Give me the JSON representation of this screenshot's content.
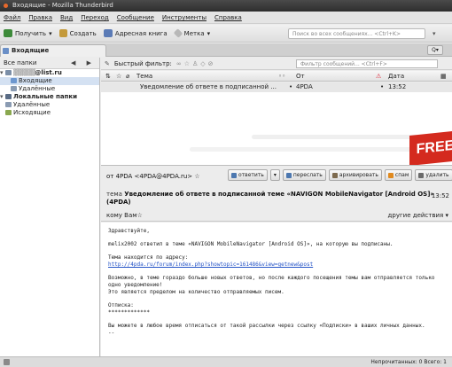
{
  "window": {
    "title": "Входящие - Mozilla Thunderbird"
  },
  "menu": [
    "Файл",
    "Правка",
    "Вид",
    "Переход",
    "Сообщение",
    "Инструменты",
    "Справка"
  ],
  "toolbar": {
    "get": "Получить",
    "write": "Создать",
    "addressbook": "Адресная книга",
    "tag": "Метка",
    "search_placeholder": "Поиск во всех сообщениях... <Ctrl+K>"
  },
  "tab": {
    "label": "Входящие"
  },
  "folders": {
    "header": "Все папки",
    "account": "@list.ru",
    "items": [
      {
        "label": "Входящие",
        "selected": true
      },
      {
        "label": "Удалённые"
      }
    ],
    "local": "Локальные папки",
    "local_items": [
      {
        "label": "Удалённые"
      },
      {
        "label": "Исходящие"
      }
    ]
  },
  "quickfilter": {
    "label": "Быстрый фильтр:",
    "placeholder": "Фильтр сообщений... <Ctrl+F>"
  },
  "columns": {
    "subject": "Тема",
    "from": "От",
    "date": "Дата"
  },
  "messages": [
    {
      "subject": "Уведомление об ответе в подписанной ...",
      "from": "4PDA",
      "date": "13:52"
    }
  ],
  "promo": "FREE",
  "message": {
    "from": "от 4PDA <4PDA@4PDA.ru>",
    "subject_label": "тема",
    "subject": "Уведомление об ответе в подписанной теме «NAVIGON MobileNavigator [Android OS]» (4PDA)",
    "time": "13:52",
    "to_label": "кому",
    "to": "Вам",
    "other_actions": "другие действия"
  },
  "actions": {
    "reply": "ответить",
    "forward": "переслать",
    "archive": "архивировать",
    "spam": "спам",
    "delete": "удалить"
  },
  "body": {
    "greeting": "Здравствуйте,",
    "line1": "melix2002 ответил в теме «NAVIGON MobileNavigator [Android OS]», на которую вы подписаны.",
    "topic_label": "Тема находится по адресу:",
    "topic_link": "http://4pda.ru/forum/index.php?showtopic=161486&view=getnew&post",
    "note1": "Возможно, в теме гораздо больше новых ответов, но после каждого посещения темы вам отправляется только",
    "note2": "одно уведомление!",
    "note3": "Это является пределом на количество отправляемых писем.",
    "unsub": "Отписка:",
    "stars": "*************",
    "footer": "Вы можете в любое время отписаться от такой рассылки через ссылку «Подписки» в ваших личных данных.",
    "last": "--"
  },
  "status": {
    "counts": "Непрочитанных: 0   Всего: 1"
  }
}
